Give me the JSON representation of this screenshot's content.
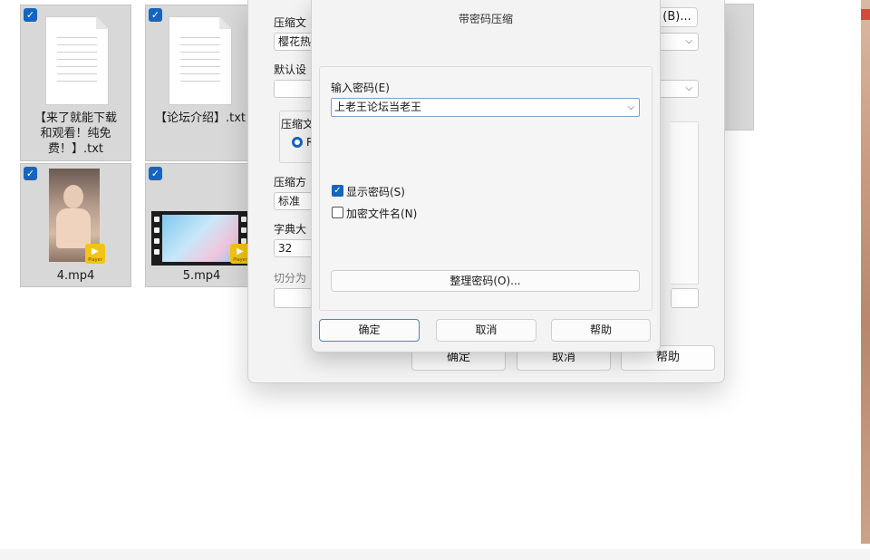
{
  "files": [
    {
      "name": "【来了就能下载和观看！纯免费！】.txt",
      "lines": [
        "【来了就能下载",
        "和观看！纯免",
        "费！】.txt"
      ],
      "kind": "text"
    },
    {
      "name": "【论坛介绍】.txt",
      "lines": [
        "【论坛介绍】.txt"
      ],
      "kind": "text"
    },
    {
      "name": "4.mp4",
      "lines": [
        "4.mp4"
      ],
      "kind": "video"
    },
    {
      "name": "5.mp4",
      "lines": [
        "5.mp4"
      ],
      "kind": "video"
    }
  ],
  "player_badge": {
    "label": "Player"
  },
  "back_dialog": {
    "archive_name_label": "压缩文",
    "archive_name_value": "樱花热",
    "browse_button": "(B)...",
    "default_settings_label": "默认设",
    "format_label": "压缩文",
    "format_option": "R",
    "method_label": "压缩方",
    "method_value": "标准",
    "dict_label": "字典大",
    "dict_value": "32",
    "split_label": "切分为",
    "ok": "确定",
    "cancel": "取消",
    "help": "帮助"
  },
  "password_dialog": {
    "title": "带密码压缩",
    "enter_password_label": "输入密码(E)",
    "password_value": "上老王论坛当老王",
    "show_password_label": "显示密码(S)",
    "show_password_checked": true,
    "encrypt_filenames_label": "加密文件名(N)",
    "encrypt_filenames_checked": false,
    "organize_button": "整理密码(O)...",
    "ok": "确定",
    "cancel": "取消",
    "help": "帮助"
  },
  "colors": {
    "accent": "#1565c0",
    "player_badge": "#f3c411"
  }
}
